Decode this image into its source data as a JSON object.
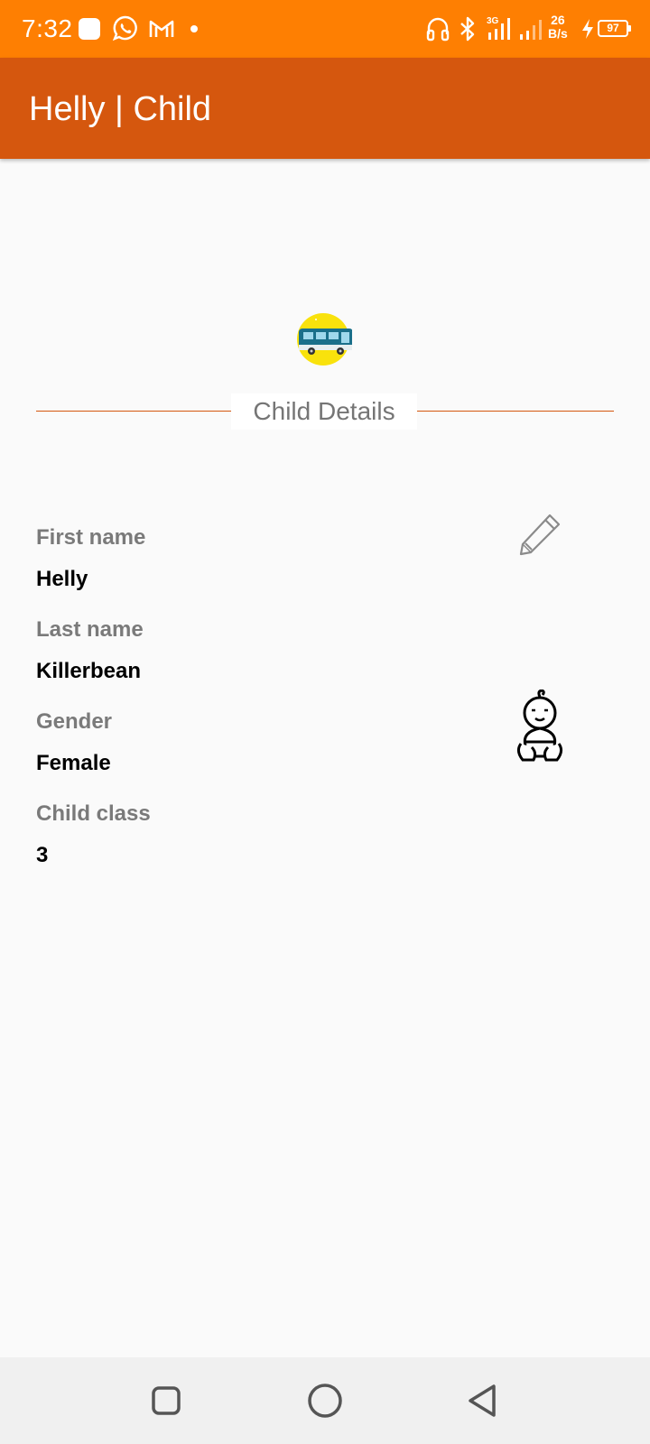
{
  "status_bar": {
    "time": "7:32",
    "net_speed_value": "26",
    "net_speed_unit": "B/s",
    "battery": "97",
    "icons": [
      "app-icon",
      "whatsapp-icon",
      "gmail-icon",
      "notification-dot-icon",
      "headphones-icon",
      "bluetooth-icon",
      "signal-3g-icon",
      "signal-icon",
      "charging-icon",
      "battery-icon"
    ]
  },
  "app_bar": {
    "title": "Helly | Child"
  },
  "section": {
    "title": "Child Details"
  },
  "fields": [
    {
      "label": "First name",
      "value": "Helly"
    },
    {
      "label": "Last name",
      "value": "Killerbean"
    },
    {
      "label": "Gender",
      "value": "Female"
    },
    {
      "label": "Child class",
      "value": "3"
    }
  ],
  "icons": {
    "logo": "school-bus-logo",
    "edit": "pencil-icon",
    "avatar": "baby-icon"
  },
  "colors": {
    "status_bar": "#fe7f02",
    "app_bar": "#d5570e",
    "accent_line": "#d5570e",
    "label": "#7a7a7a",
    "background": "#fafafa"
  },
  "nav_bar": {
    "buttons": [
      "recents-button",
      "home-button",
      "back-button"
    ]
  }
}
